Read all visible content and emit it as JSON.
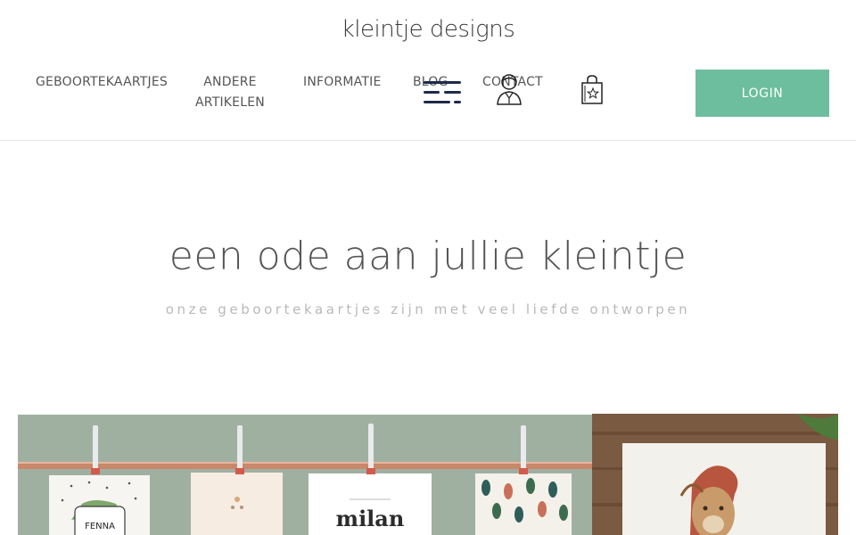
{
  "header": {
    "logo_text": "kleintje designs",
    "nav": {
      "geboortekaartjes": "GEBOORTEKAARTJES",
      "andere_line1": "ANDERE",
      "andere_line2": "ARTIKELEN",
      "informatie": "INFORMATIE",
      "blog": "BLOG",
      "contact": "CONTACT"
    },
    "icons": [
      "menu-icon",
      "user-icon",
      "shopping-bag-icon"
    ],
    "login_label": "LOGIN"
  },
  "hero": {
    "title": "een ode aan jullie kleintje",
    "subtitle": "onze geboortekaartjes zijn met veel liefde ontworpen"
  },
  "gallery": {
    "left_card_name_1": "FENNA",
    "left_card_name_2": "milan"
  },
  "colors": {
    "accent": "#6dbe9f",
    "nav_text": "#555555",
    "icon_navy": "#1f2a4a",
    "wall_green": "#a2b3a4",
    "copper_rod": "#c9886b",
    "wood": "#7a5a40"
  }
}
